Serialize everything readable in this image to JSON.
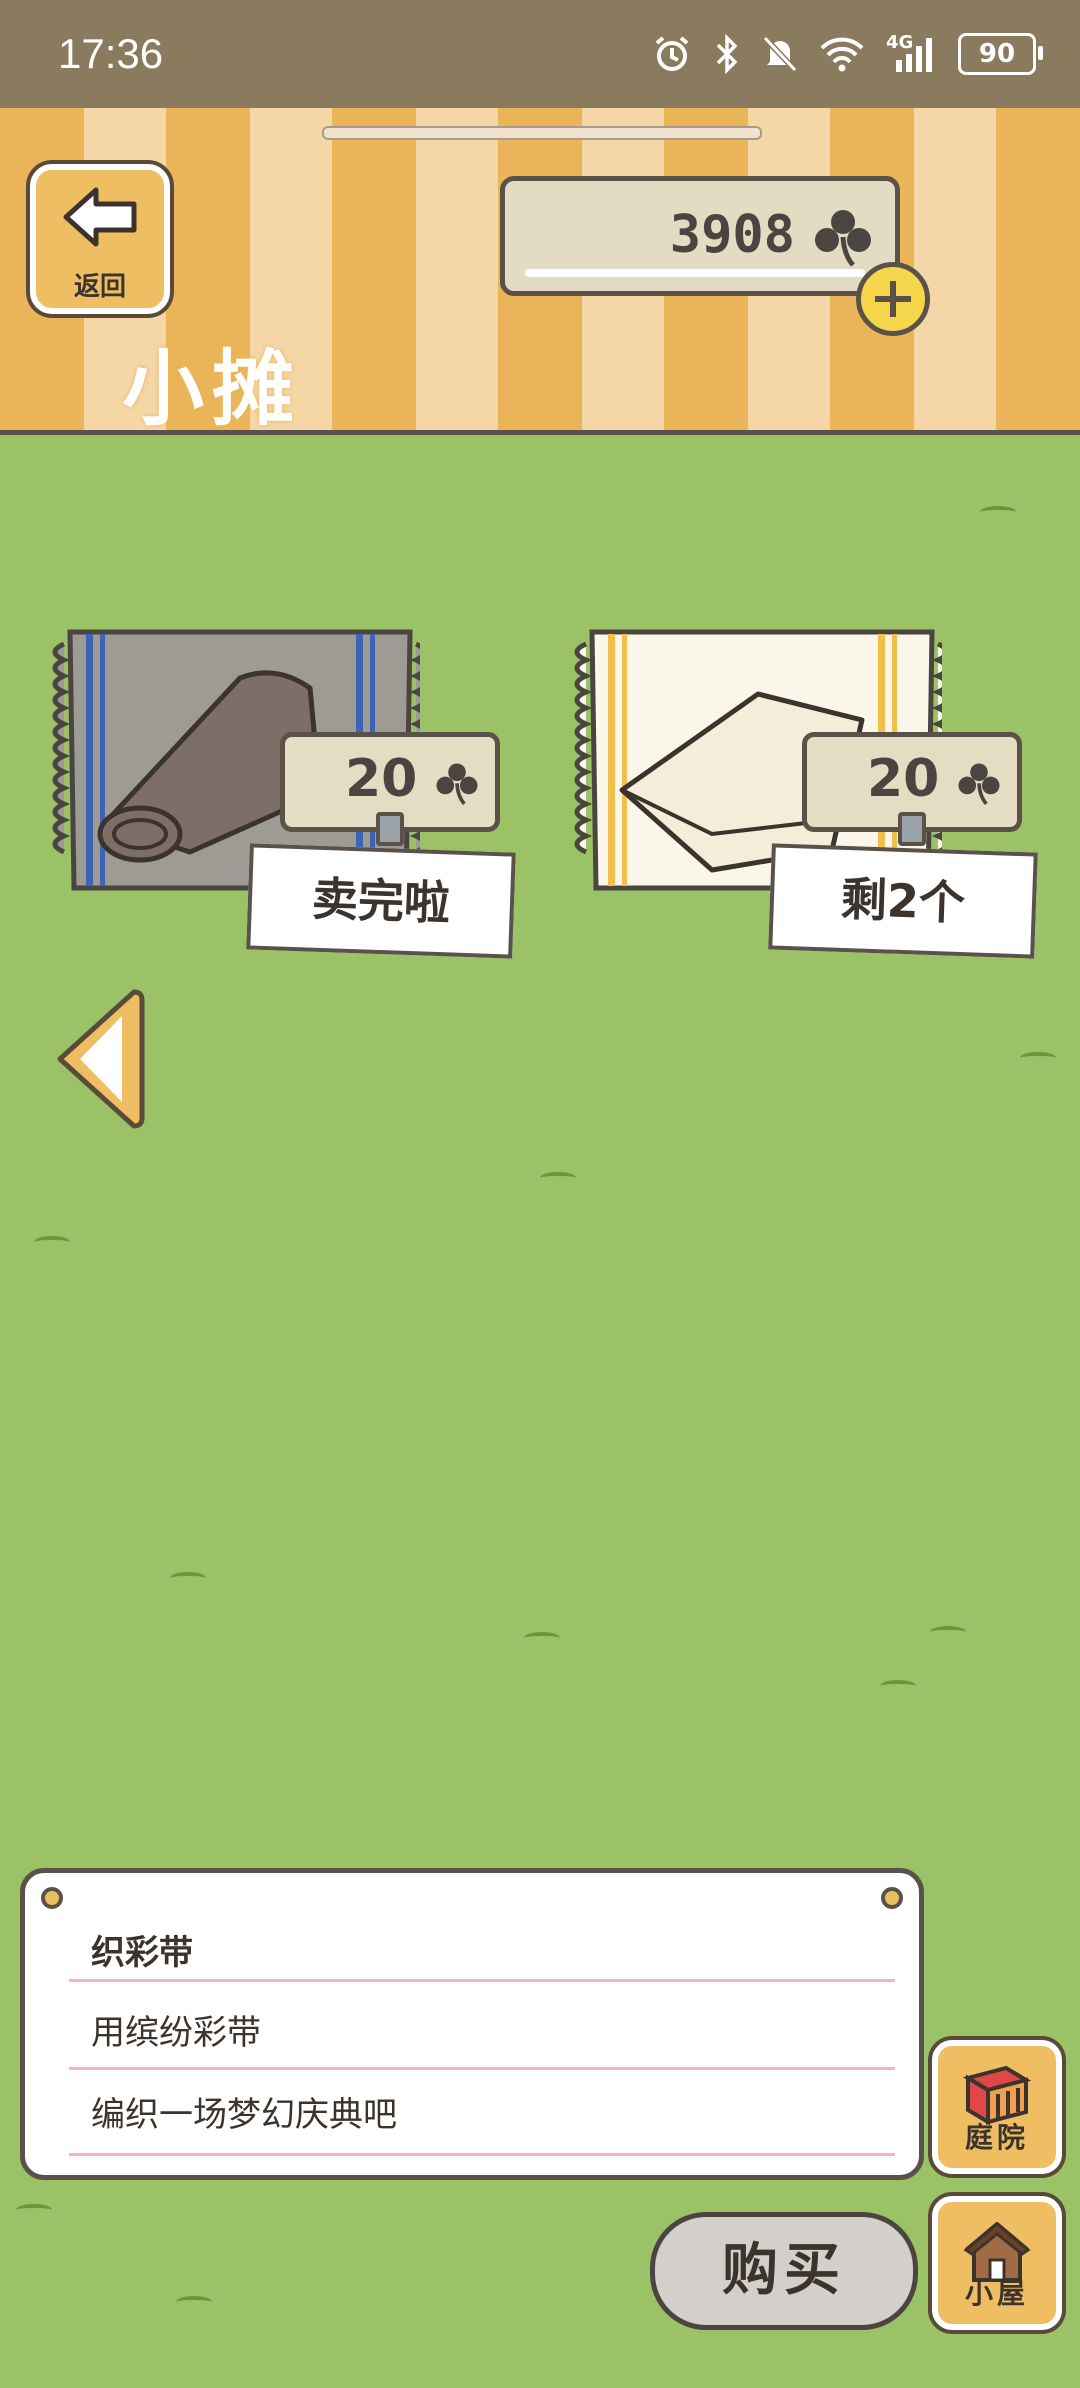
{
  "status_bar": {
    "time": "17:36",
    "network": "4G",
    "battery": "90"
  },
  "header": {
    "back_label": "返回",
    "title": "小摊",
    "currency_value": "3908"
  },
  "items": [
    {
      "price": "20",
      "status": "卖完啦",
      "color": "#7d6f68"
    },
    {
      "price": "20",
      "status": "剩2个",
      "color": "#f5ecd9"
    }
  ],
  "description": {
    "name": "织彩带",
    "line1": "用缤纷彩带",
    "line2": "编织一场梦幻庆典吧"
  },
  "side_buttons": {
    "yard": "庭院",
    "house": "小屋"
  },
  "buy_label": "购买"
}
